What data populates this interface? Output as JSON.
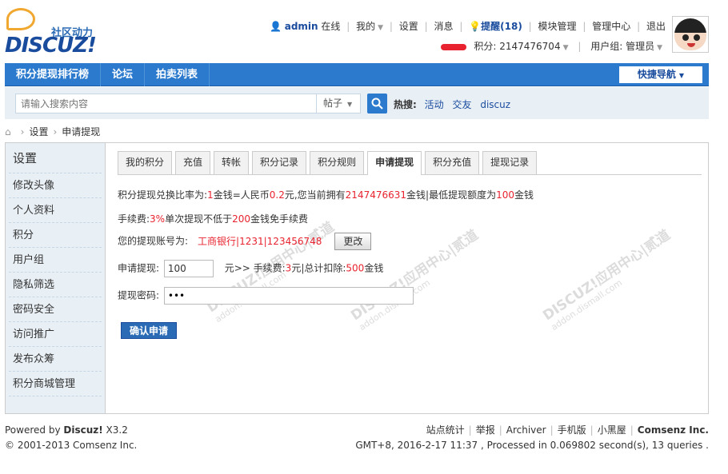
{
  "logo": {
    "text": "DISCUZ!",
    "slogan": "社区动力"
  },
  "user_bar": {
    "username": "admin",
    "online": "在线",
    "my": "我的",
    "settings": "设置",
    "messages": "消息",
    "remind": "提醒(18)",
    "module_manage": "模块管理",
    "admin_center": "管理中心",
    "logout": "退出",
    "points": "积分: 2147476704",
    "usergroup": "用户组: 管理员"
  },
  "nav": {
    "items": [
      "积分提现排行榜",
      "论坛",
      "拍卖列表"
    ],
    "quick_nav": "快捷导航"
  },
  "search": {
    "placeholder": "请输入搜索内容",
    "type": "帖子",
    "hot_label": "热搜:",
    "hot_items": [
      "活动",
      "交友",
      "discuz"
    ]
  },
  "breadcrumb": {
    "items": [
      "设置",
      "申请提现"
    ]
  },
  "sidebar": {
    "title": "设置",
    "items": [
      "修改头像",
      "个人资料",
      "积分",
      "用户组",
      "隐私筛选",
      "密码安全",
      "访问推广",
      "发布众筹",
      "积分商城管理"
    ]
  },
  "tabs": {
    "items": [
      "我的积分",
      "充值",
      "转帐",
      "积分记录",
      "积分规则",
      "申请提现",
      "积分充值",
      "提现记录"
    ],
    "active": "申请提现"
  },
  "form": {
    "rate_1": "积分提现兑换比率为:",
    "rate_coin_num": "1",
    "rate_2": "金钱=人民币",
    "rate_rmb": "0.2",
    "rate_3": "元,您当前拥有",
    "rate_owned": "2147476631",
    "rate_4": "金钱|最低提现额度为",
    "rate_min": "100",
    "rate_5": "金钱",
    "fee_1": "手续费:",
    "fee_pct": "3%",
    "fee_2": "单次提现不低于",
    "fee_min": "200",
    "fee_3": "金钱免手续费",
    "account_label": "您的提现账号为:",
    "account_value": "工商银行|1231|123456748",
    "change_button": "更改",
    "apply_label": "申请提现:",
    "apply_value": "100",
    "apply_1": "元>>  手续费:",
    "apply_fee": "3",
    "apply_2": "元|总计扣除:",
    "apply_total": "500",
    "apply_3": "金钱",
    "password_label": "提现密码:",
    "password_value": "•••",
    "submit_button": "确认申请"
  },
  "footer": {
    "powered_prefix": "Powered by ",
    "powered_name": "Discuz!",
    "powered_version": " X3.2",
    "copyright": "© 2001-2013 Comsenz Inc.",
    "links": [
      "站点统计",
      "举报",
      "Archiver",
      "手机版",
      "小黑屋"
    ],
    "company": "Comsenz Inc.",
    "status": "GMT+8, 2016-2-17 11:37 , Processed in 0.069802 second(s), 13 queries ."
  }
}
